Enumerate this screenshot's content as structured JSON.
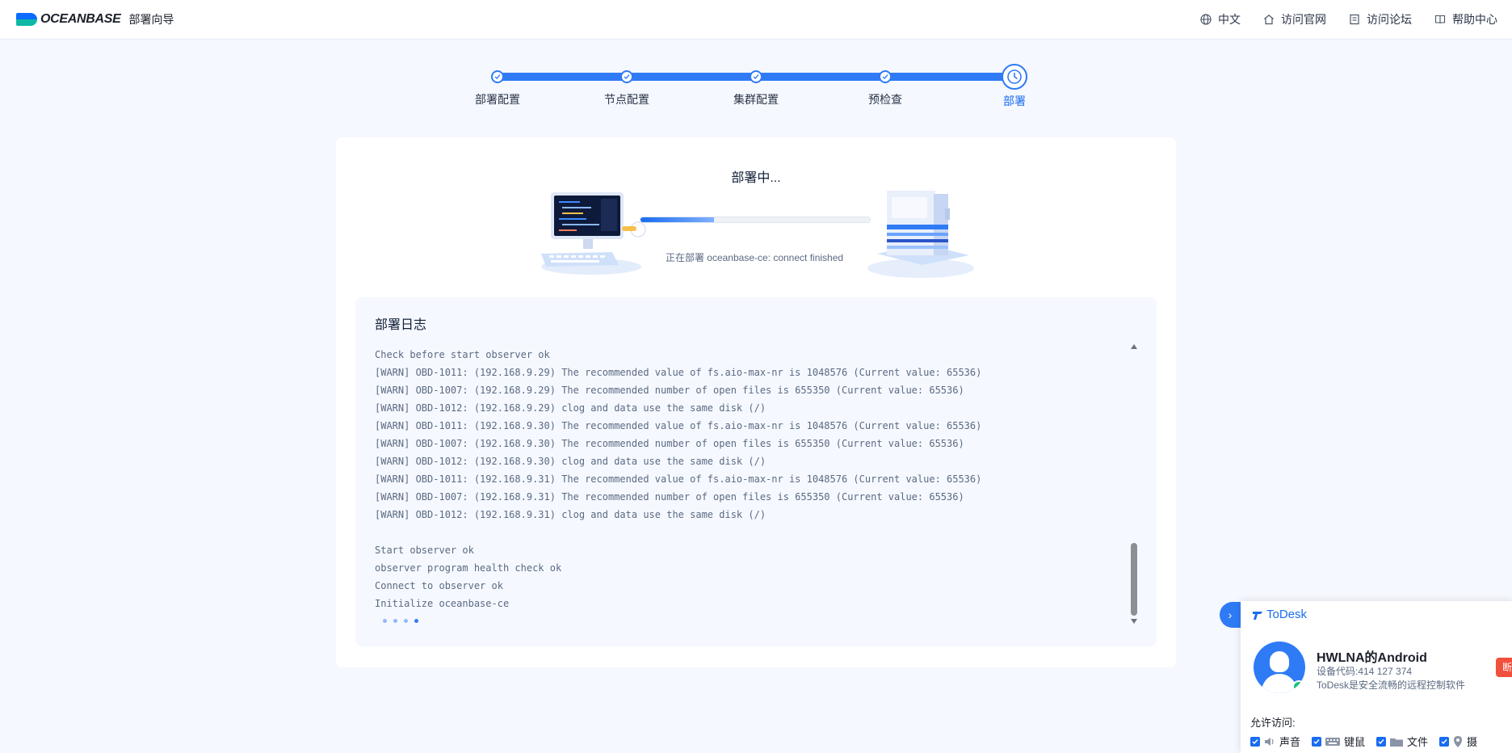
{
  "header": {
    "logo_text": "OCEANBASE",
    "subtitle": "部署向导",
    "nav": [
      {
        "label": "中文",
        "icon": "globe-icon"
      },
      {
        "label": "访问官网",
        "icon": "home-icon"
      },
      {
        "label": "访问论坛",
        "icon": "forum-icon"
      },
      {
        "label": "帮助中心",
        "icon": "book-icon"
      }
    ]
  },
  "steps": [
    {
      "label": "部署配置",
      "state": "done"
    },
    {
      "label": "节点配置",
      "state": "done"
    },
    {
      "label": "集群配置",
      "state": "done"
    },
    {
      "label": "预检查",
      "state": "done"
    },
    {
      "label": "部署",
      "state": "active"
    }
  ],
  "deploy": {
    "status_title": "部署中...",
    "progress": 0.32,
    "progress_text": "正在部署 oceanbase-ce: connect finished"
  },
  "log": {
    "title": "部署日志",
    "lines": [
      "Check before start observer ok",
      "[WARN] OBD-1011: (192.168.9.29) The recommended value of fs.aio-max-nr is 1048576 (Current value: 65536)",
      "[WARN] OBD-1007: (192.168.9.29) The recommended number of open files is 655350 (Current value: 65536)",
      "[WARN] OBD-1012: (192.168.9.29) clog and data use the same disk (/)",
      "[WARN] OBD-1011: (192.168.9.30) The recommended value of fs.aio-max-nr is 1048576 (Current value: 65536)",
      "[WARN] OBD-1007: (192.168.9.30) The recommended number of open files is 655350 (Current value: 65536)",
      "[WARN] OBD-1012: (192.168.9.30) clog and data use the same disk (/)",
      "[WARN] OBD-1011: (192.168.9.31) The recommended value of fs.aio-max-nr is 1048576 (Current value: 65536)",
      "[WARN] OBD-1007: (192.168.9.31) The recommended number of open files is 655350 (Current value: 65536)",
      "[WARN] OBD-1012: (192.168.9.31) clog and data use the same disk (/)",
      "",
      "Start observer ok",
      "observer program health check ok",
      "Connect to observer ok",
      "Initialize oceanbase-ce"
    ]
  },
  "todesk": {
    "brand": "ToDesk",
    "device_name": "HWLNA的Android",
    "device_code": "设备代码:414 127 374",
    "description": "ToDesk是安全流畅的远程控制软件",
    "disconnect": "断",
    "allow_label": "允许访问:",
    "permissions": [
      {
        "label": "声音",
        "icon": "speaker-icon",
        "checked": true
      },
      {
        "label": "键鼠",
        "icon": "keyboard-icon",
        "checked": true
      },
      {
        "label": "文件",
        "icon": "folder-icon",
        "checked": true
      },
      {
        "label": "摄",
        "icon": "location-icon",
        "checked": true
      }
    ]
  }
}
